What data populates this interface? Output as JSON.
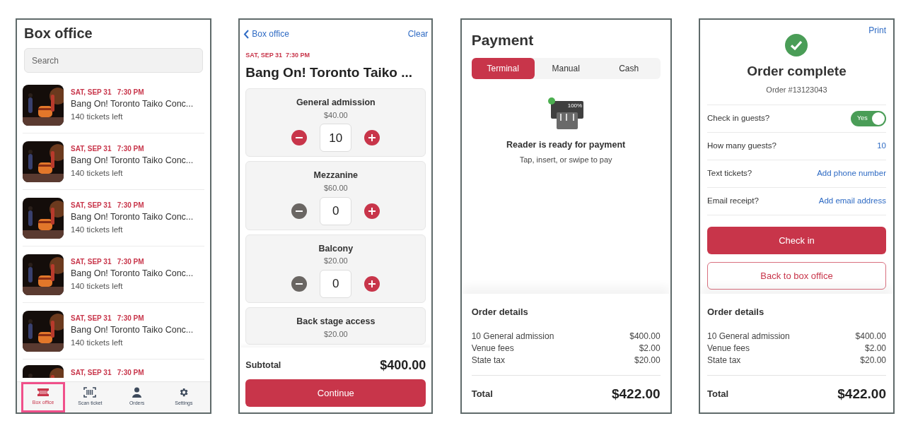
{
  "box_office": {
    "title": "Box office",
    "search": {
      "placeholder": "Search"
    },
    "events": [
      {
        "date": "SAT, SEP 31   7:30 PM",
        "name": "Bang On! Toronto Taiko Conc...",
        "tickets": "140 tickets left"
      },
      {
        "date": "SAT, SEP 31   7:30 PM",
        "name": "Bang On! Toronto Taiko Conc...",
        "tickets": "140 tickets left"
      },
      {
        "date": "SAT, SEP 31   7:30 PM",
        "name": "Bang On! Toronto Taiko Conc...",
        "tickets": "140 tickets left"
      },
      {
        "date": "SAT, SEP 31   7:30 PM",
        "name": "Bang On! Toronto Taiko Conc...",
        "tickets": "140 tickets left"
      },
      {
        "date": "SAT, SEP 31   7:30 PM",
        "name": "Bang On! Toronto Taiko Conc...",
        "tickets": "140 tickets left"
      },
      {
        "date": "SAT, SEP 31   7:30 PM"
      }
    ],
    "nav": [
      {
        "label": "Box office",
        "kind": "ticket",
        "selected": true
      },
      {
        "label": "Scan ticket",
        "kind": "scan",
        "selected": false
      },
      {
        "label": "Orders",
        "kind": "person",
        "selected": false
      },
      {
        "label": "Settings",
        "kind": "gear",
        "selected": false
      }
    ]
  },
  "tickets": {
    "back": "Box office",
    "clear": "Clear",
    "date": "SAT, SEP 31  7:30 PM",
    "title": "Bang On! Toronto Taiko ...",
    "types": [
      {
        "name": "General admission",
        "price": "$40.00",
        "quantity": "10",
        "minus_disabled": false
      },
      {
        "name": "Mezzanine",
        "price": "$60.00",
        "quantity": "0",
        "minus_disabled": true
      },
      {
        "name": "Balcony",
        "price": "$20.00",
        "quantity": "0",
        "minus_disabled": true
      },
      {
        "name": "Back stage access",
        "price": "$20.00"
      }
    ],
    "subtotal_label": "Subtotal",
    "subtotal": "$400.00",
    "continue": "Continue"
  },
  "payment": {
    "title": "Payment",
    "tabs": [
      {
        "label": "Terminal",
        "selected": true
      },
      {
        "label": "Manual",
        "selected": false
      },
      {
        "label": "Cash",
        "selected": false
      }
    ],
    "reader": {
      "battery": "100%",
      "connected": true,
      "status": "Reader is ready for payment",
      "hint": "Tap, insert, or swipe to pay"
    },
    "order_details": {
      "title": "Order details",
      "lines": [
        {
          "label": "10 General admission",
          "amount": "$400.00"
        },
        {
          "label": "Venue fees",
          "amount": "$2.00"
        },
        {
          "label": "State tax",
          "amount": "$20.00"
        }
      ],
      "total_label": "Total",
      "total": "$422.00"
    }
  },
  "complete": {
    "print": "Print",
    "title": "Order complete",
    "order_number": "Order #13123043",
    "rows": [
      {
        "label": "Check in guests?",
        "kind": "toggle",
        "value": "Yes",
        "on": true
      },
      {
        "label": "How many guests?",
        "kind": "link",
        "value": "10"
      },
      {
        "label": "Text tickets?",
        "kind": "link",
        "value": "Add phone number"
      },
      {
        "label": "Email receipt?",
        "kind": "link",
        "value": "Add email address"
      }
    ],
    "check_in": "Check in",
    "back": "Back to box office",
    "order_details": {
      "title": "Order details",
      "lines": [
        {
          "label": "10 General admission",
          "amount": "$400.00"
        },
        {
          "label": "Venue fees",
          "amount": "$2.00"
        },
        {
          "label": "State tax",
          "amount": "$20.00"
        }
      ],
      "total_label": "Total",
      "total": "$422.00"
    }
  }
}
